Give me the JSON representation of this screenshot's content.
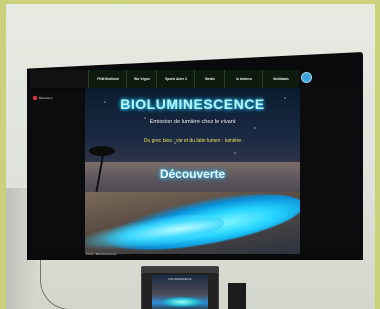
{
  "nav": {
    "items": [
      {
        "label": "PNM Bioillumi"
      },
      {
        "label": "Bio Végan"
      },
      {
        "label": "Sports Autre 3"
      },
      {
        "label": "Bestis"
      },
      {
        "label": "lo lumineu"
      },
      {
        "label": "Multitasks"
      }
    ]
  },
  "side": {
    "logo_label": "Biophoton"
  },
  "slide": {
    "title": "BIOLUMINESCENCE",
    "subtitle": "Emission de lumière chez le vivant",
    "etymology": "Du grec bios : vie et du latin lumen : lumière",
    "cta": "Découverte"
  },
  "footer": {
    "caption": "Photo : Bioluminescence"
  },
  "laptop": {
    "caption": "BIOLUMINESCENCE"
  },
  "colors": {
    "title_glow": "#35d0ff",
    "etymology": "#e8e158",
    "wave": "#25d4ff"
  }
}
